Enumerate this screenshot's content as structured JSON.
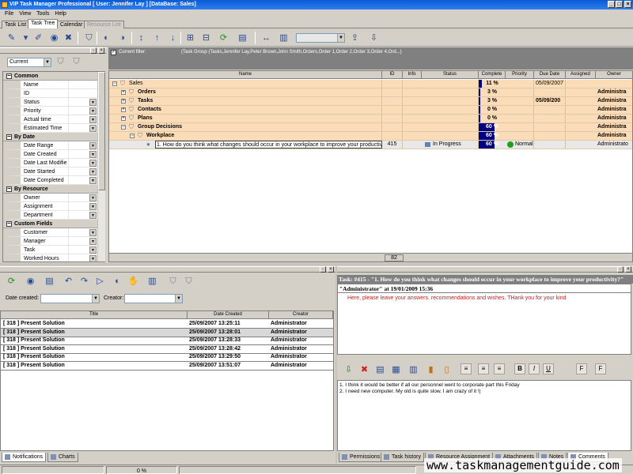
{
  "window": {
    "title": "VIP Task Manager Professional [ User: Jennifer Lay ] [DataBase: Sales]"
  },
  "menu": [
    "File",
    "View",
    "Tools",
    "Help"
  ],
  "view_tabs": [
    {
      "label": "Task List",
      "state": "normal"
    },
    {
      "label": "Task Tree",
      "state": "active"
    },
    {
      "label": "Calendar",
      "state": "normal"
    },
    {
      "label": "Resource List",
      "state": "disabled"
    }
  ],
  "left": {
    "view_select": "Current",
    "groups": [
      {
        "label": "Common",
        "items": [
          {
            "label": "Name",
            "dropdown": false
          },
          {
            "label": "ID",
            "dropdown": false
          },
          {
            "label": "Status",
            "dropdown": true
          },
          {
            "label": "Priority",
            "dropdown": true
          },
          {
            "label": "Actual time",
            "dropdown": true
          },
          {
            "label": "Estimated Time",
            "dropdown": true
          }
        ]
      },
      {
        "label": "By Date",
        "items": [
          {
            "label": "Date Range",
            "dropdown": true
          },
          {
            "label": "Date Created",
            "dropdown": true
          },
          {
            "label": "Date Last Modifie",
            "dropdown": true
          },
          {
            "label": "Date Started",
            "dropdown": true
          },
          {
            "label": "Date Completed",
            "dropdown": true
          }
        ]
      },
      {
        "label": "By Resource",
        "items": [
          {
            "label": "Owner",
            "dropdown": true
          },
          {
            "label": "Assignment",
            "dropdown": true
          },
          {
            "label": "Department",
            "dropdown": true
          }
        ]
      },
      {
        "label": "Custom Fields",
        "items": [
          {
            "label": "Customer",
            "dropdown": true
          },
          {
            "label": "Manager",
            "dropdown": true
          },
          {
            "label": "Task",
            "dropdown": true
          },
          {
            "label": "Worked Hours",
            "dropdown": true
          }
        ]
      }
    ]
  },
  "filter": {
    "label": "Current filter:",
    "text": "(Task Group  (Tasks,Jennifer Lay,Peter Brown,John Smith,Orders,Order 1,Order 2,Order 3,Order 4,Ord...)"
  },
  "grid": {
    "columns": [
      "Name",
      "ID",
      "Info",
      "Status",
      "Complete",
      "Priority",
      "Due Date",
      "Assigned",
      "Owner"
    ],
    "rows": [
      {
        "name": "Sales",
        "level": 0,
        "expander": "−",
        "bold": false,
        "id": "",
        "status": "",
        "complete": "11 %",
        "complete_value": 11,
        "priority": "",
        "due": "05/09/2007",
        "owner": "",
        "selected": false
      },
      {
        "name": "Orders",
        "level": 1,
        "expander": "+",
        "bold": true,
        "id": "",
        "status": "",
        "complete": "3 %",
        "complete_value": 3,
        "priority": "",
        "due": "",
        "owner": "Administra",
        "selected": false
      },
      {
        "name": "Tasks",
        "level": 1,
        "expander": "+",
        "bold": true,
        "id": "",
        "status": "",
        "complete": "3 %",
        "complete_value": 3,
        "priority": "",
        "due": "05/09/200",
        "owner": "Administra",
        "selected": false
      },
      {
        "name": "Contacts",
        "level": 1,
        "expander": "+",
        "bold": true,
        "id": "",
        "status": "",
        "complete": "0 %",
        "complete_value": 0,
        "priority": "",
        "due": "",
        "owner": "Administra",
        "selected": false
      },
      {
        "name": "Plans",
        "level": 1,
        "expander": "+",
        "bold": true,
        "id": "",
        "status": "",
        "complete": "0 %",
        "complete_value": 0,
        "priority": "",
        "due": "",
        "owner": "Administra",
        "selected": false
      },
      {
        "name": "Group Decisions",
        "level": 1,
        "expander": "−",
        "bold": true,
        "id": "",
        "status": "",
        "complete": "60 %",
        "complete_value": 60,
        "priority": "",
        "due": "",
        "owner": "Administra",
        "selected": false
      },
      {
        "name": "Workplace",
        "level": 2,
        "expander": "−",
        "bold": true,
        "id": "",
        "status": "",
        "complete": "60 %",
        "complete_value": 60,
        "priority": "",
        "due": "",
        "owner": "Administra",
        "selected": false
      },
      {
        "name": "1. How do you think what changes should occur in your workplace to improve your productivity?",
        "level": 3,
        "expander": "",
        "bold": false,
        "id": "415",
        "status": "In Progress",
        "complete": "60 %",
        "complete_value": 60,
        "priority": "Normal",
        "due": "",
        "owner": "Administrato",
        "selected": true
      }
    ],
    "footer_count": "82"
  },
  "notifications": {
    "date_created_label": "Date created:",
    "creator_label": "Creator:",
    "columns": [
      "Title",
      "Date Created",
      "Creator"
    ],
    "rows": [
      {
        "title": "[ 318 ] Present Solution",
        "date": "25/09/2007 13:25:11",
        "creator": "Administrator",
        "selected": false
      },
      {
        "title": "[ 318 ] Present Solution",
        "date": "25/09/2007 13:28:01",
        "creator": "Administrator",
        "selected": true
      },
      {
        "title": "[ 318 ] Present Solution",
        "date": "25/09/2007 13:28:33",
        "creator": "Administrator",
        "selected": false
      },
      {
        "title": "[ 318 ] Present Solution",
        "date": "25/09/2007 13:28:42",
        "creator": "Administrator",
        "selected": false
      },
      {
        "title": "[ 318 ] Present Solution",
        "date": "25/09/2007 13:29:50",
        "creator": "Administrator",
        "selected": false
      },
      {
        "title": "[ 318 ] Present Solution",
        "date": "25/09/2007 13:51:07",
        "creator": "Administrator",
        "selected": false
      }
    ],
    "tabs": [
      "Notifications",
      "Charts"
    ]
  },
  "task_detail": {
    "title": "Task: #415 - \"1. How do you think what changes should occur in your workplace to improve your productivity?\"",
    "author_line": "\"Administrator\" at 19/01/2009 15:36",
    "description": "Here, please leave your answers. recommendations and wishes. THank you for your kind",
    "comments": [
      "1. I think it would be better if all our personnel went to corporate part this Friday",
      "2. I need new computer. My old is quite slow. I am crazy of it !|"
    ],
    "tabs": [
      "Permissions",
      "Task history",
      "Resource Assignment",
      "Attachments",
      "Notes",
      "Comments"
    ]
  },
  "status": {
    "progress": "0 %"
  },
  "watermark": "www.taskmanagementguide.com",
  "colors": {
    "group_row": "#fbdcb8",
    "progress": "#000080",
    "titlebar": "#0a5bd6"
  }
}
